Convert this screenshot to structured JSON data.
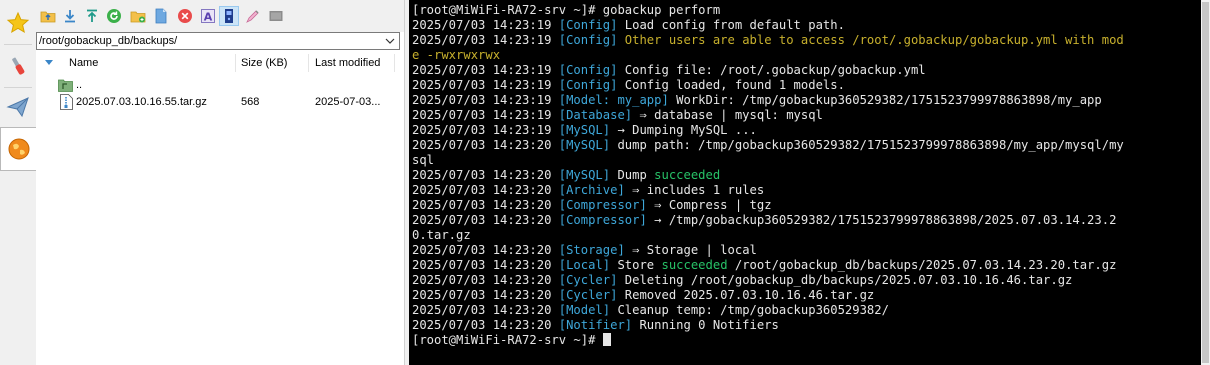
{
  "sidebar": {
    "tabs": [
      {
        "name": "favorites",
        "icon": "star-icon"
      },
      {
        "name": "tools",
        "icon": "tools-icon"
      },
      {
        "name": "send",
        "icon": "paper-plane-icon"
      },
      {
        "name": "sftp",
        "icon": "globe-icon"
      }
    ],
    "active_index": 3
  },
  "file_browser": {
    "toolbar": [
      "folder-up-icon",
      "download-icon",
      "upload-icon",
      "refresh-icon",
      "new-folder-icon",
      "new-file-icon",
      "delete-icon",
      "rename-icon",
      "terminal-follow-icon",
      "edit-icon",
      "hidden-files-icon"
    ],
    "path": "/root/gobackup_db/backups/",
    "columns": {
      "name": "Name",
      "size": "Size (KB)",
      "modified": "Last modified"
    },
    "rows": [
      {
        "name": "..",
        "size": "",
        "modified": "",
        "icon": "parent-folder-icon"
      },
      {
        "name": "2025.07.03.10.16.55.tar.gz",
        "size": "568",
        "modified": "2025-07-03...",
        "icon": "archive-file-icon"
      }
    ]
  },
  "terminal": {
    "lines": [
      [
        {
          "t": "[root@MiWiFi-RA72-srv ~]# gobackup perform"
        }
      ],
      [
        {
          "t": "2025/07/03 14:23:19 "
        },
        {
          "t": "[Config]",
          "c": "tag"
        },
        {
          "t": " Load config from default path."
        }
      ],
      [
        {
          "t": "2025/07/03 14:23:19 "
        },
        {
          "t": "[Config]",
          "c": "tag"
        },
        {
          "t": " Other users are able to access /root/.gobackup/gobackup.yml with mod",
          "c": "warn"
        }
      ],
      [
        {
          "t": "e -rwxrwxrwx",
          "c": "warn"
        }
      ],
      [
        {
          "t": "2025/07/03 14:23:19 "
        },
        {
          "t": "[Config]",
          "c": "tag"
        },
        {
          "t": " Config file: /root/.gobackup/gobackup.yml"
        }
      ],
      [
        {
          "t": "2025/07/03 14:23:19 "
        },
        {
          "t": "[Config]",
          "c": "tag"
        },
        {
          "t": " Config loaded, found 1 models."
        }
      ],
      [
        {
          "t": "2025/07/03 14:23:19 "
        },
        {
          "t": "[Model: my_app]",
          "c": "tag"
        },
        {
          "t": " WorkDir: /tmp/gobackup360529382/1751523799978863898/my_app"
        }
      ],
      [
        {
          "t": "2025/07/03 14:23:19 "
        },
        {
          "t": "[Database]",
          "c": "tag"
        },
        {
          "t": " ⇒ database | mysql: mysql"
        }
      ],
      [
        {
          "t": "2025/07/03 14:23:19 "
        },
        {
          "t": "[MySQL]",
          "c": "tag"
        },
        {
          "t": " → Dumping MySQL ..."
        }
      ],
      [
        {
          "t": "2025/07/03 14:23:20 "
        },
        {
          "t": "[MySQL]",
          "c": "tag"
        },
        {
          "t": " dump path: /tmp/gobackup360529382/1751523799978863898/my_app/mysql/my"
        }
      ],
      [
        {
          "t": "sql"
        }
      ],
      [
        {
          "t": "2025/07/03 14:23:20 "
        },
        {
          "t": "[MySQL]",
          "c": "tag"
        },
        {
          "t": " Dump "
        },
        {
          "t": "succeeded",
          "c": "ok"
        }
      ],
      [
        {
          "t": "2025/07/03 14:23:20 "
        },
        {
          "t": "[Archive]",
          "c": "tag"
        },
        {
          "t": " ⇒ includes 1 rules"
        }
      ],
      [
        {
          "t": "2025/07/03 14:23:20 "
        },
        {
          "t": "[Compressor]",
          "c": "tag"
        },
        {
          "t": " ⇒ Compress | tgz"
        }
      ],
      [
        {
          "t": "2025/07/03 14:23:20 "
        },
        {
          "t": "[Compressor]",
          "c": "tag"
        },
        {
          "t": " → /tmp/gobackup360529382/1751523799978863898/2025.07.03.14.23.2"
        }
      ],
      [
        {
          "t": "0.tar.gz"
        }
      ],
      [
        {
          "t": "2025/07/03 14:23:20 "
        },
        {
          "t": "[Storage]",
          "c": "tag"
        },
        {
          "t": " ⇒ Storage | local"
        }
      ],
      [
        {
          "t": "2025/07/03 14:23:20 "
        },
        {
          "t": "[Local]",
          "c": "tag"
        },
        {
          "t": " Store "
        },
        {
          "t": "succeeded",
          "c": "ok"
        },
        {
          "t": " /root/gobackup_db/backups/2025.07.03.14.23.20.tar.gz"
        }
      ],
      [
        {
          "t": "2025/07/03 14:23:20 "
        },
        {
          "t": "[Cycler]",
          "c": "tag"
        },
        {
          "t": " Deleting /root/gobackup_db/backups/2025.07.03.10.16.46.tar.gz"
        }
      ],
      [
        {
          "t": "2025/07/03 14:23:20 "
        },
        {
          "t": "[Cycler]",
          "c": "tag"
        },
        {
          "t": " Removed 2025.07.03.10.16.46.tar.gz"
        }
      ],
      [
        {
          "t": "2025/07/03 14:23:20 "
        },
        {
          "t": "[Model]",
          "c": "tag"
        },
        {
          "t": " Cleanup temp: /tmp/gobackup360529382/"
        }
      ],
      [
        {
          "t": "2025/07/03 14:23:20 "
        },
        {
          "t": "[Notifier]",
          "c": "tag"
        },
        {
          "t": " Running 0 Notifiers"
        }
      ],
      [
        {
          "t": "[root@MiWiFi-RA72-srv ~]# "
        }
      ]
    ],
    "colors": {
      "background": "#000000",
      "text": "#e6e6e6",
      "tag": "#3ea7d9",
      "success": "#27c267",
      "warning": "#c7b02d"
    }
  }
}
